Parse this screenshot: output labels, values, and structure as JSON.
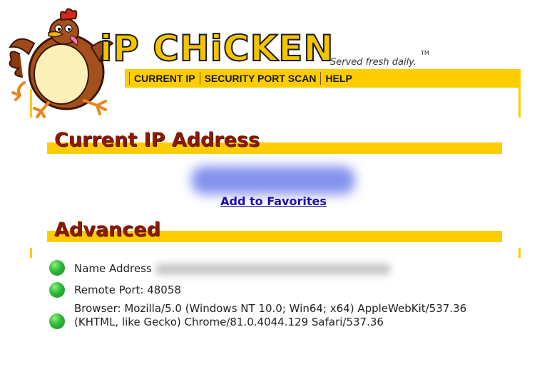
{
  "site": {
    "logo_text": "iP CHiCKEN",
    "tagline": "Served fresh daily.",
    "trademark": "TM",
    "logo_color": "#f5c400",
    "accent_color": "#ffcc00",
    "title_color": "#8b1a00"
  },
  "nav": {
    "items": [
      {
        "label": "CURRENT IP"
      },
      {
        "label": "SECURITY PORT SCAN"
      },
      {
        "label": "HELP"
      }
    ]
  },
  "current_ip": {
    "heading": "Current IP Address",
    "ip_value": "",
    "favorites_link": "Add to Favorites"
  },
  "advanced": {
    "heading": "Advanced",
    "rows": [
      {
        "label": "Name Address",
        "value": ""
      },
      {
        "label": "Remote Port: 48058"
      },
      {
        "label": "Browser: Mozilla/5.0 (Windows NT 10.0; Win64; x64) AppleWebKit/537.36 (KHTML, like Gecko) Chrome/81.0.4044.129 Safari/537.36"
      }
    ],
    "status_color": "#2fb83a"
  }
}
